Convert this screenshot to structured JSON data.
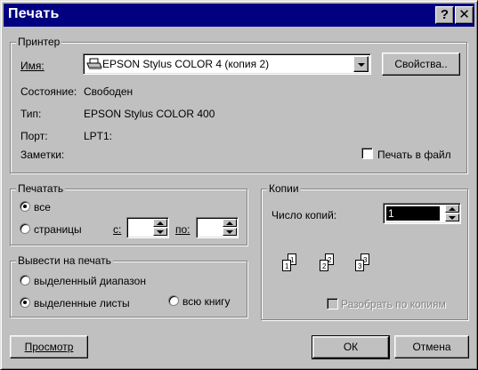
{
  "window": {
    "title": "Печать",
    "help_glyph": "?",
    "close_glyph": "✕"
  },
  "printer": {
    "group_label": "Принтер",
    "name_label": "Имя:",
    "name_value": "EPSON Stylus COLOR 4 (копия 2)",
    "properties_button": "Свойства..",
    "status_label": "Состояние:",
    "status_value": "Свободен",
    "type_label": "Тип:",
    "type_value": "EPSON Stylus COLOR 400",
    "port_label": "Порт:",
    "port_value": "LPT1:",
    "notes_label": "Заметки:",
    "print_to_file_label": "Печать в файл",
    "print_to_file_checked": false
  },
  "range": {
    "group_label": "Печатать",
    "all_label": "все",
    "pages_label": "страницы",
    "from_label": "с:",
    "to_label": "по:",
    "from_value": "",
    "to_value": "",
    "selected": "all"
  },
  "print_what": {
    "group_label": "Вывести на печать",
    "selection_label": "выделенный диапазон",
    "sheets_label": "выделенные листы",
    "workbook_label": "всю книгу",
    "selected": "sheets"
  },
  "copies": {
    "group_label": "Копии",
    "count_label": "Число копий:",
    "count_value": "1",
    "collate_label": "Разобрать по копиям",
    "collate_checked": false,
    "collate_enabled": false,
    "illustration_digits": [
      "1",
      "1",
      "2",
      "2",
      "3",
      "3"
    ]
  },
  "footer": {
    "preview_button": "Просмотр",
    "ok_button": "ОК",
    "cancel_button": "Отмена"
  },
  "colors": {
    "face": "#c0c0c0",
    "titlebar": "#000080",
    "selection": "#000000"
  }
}
